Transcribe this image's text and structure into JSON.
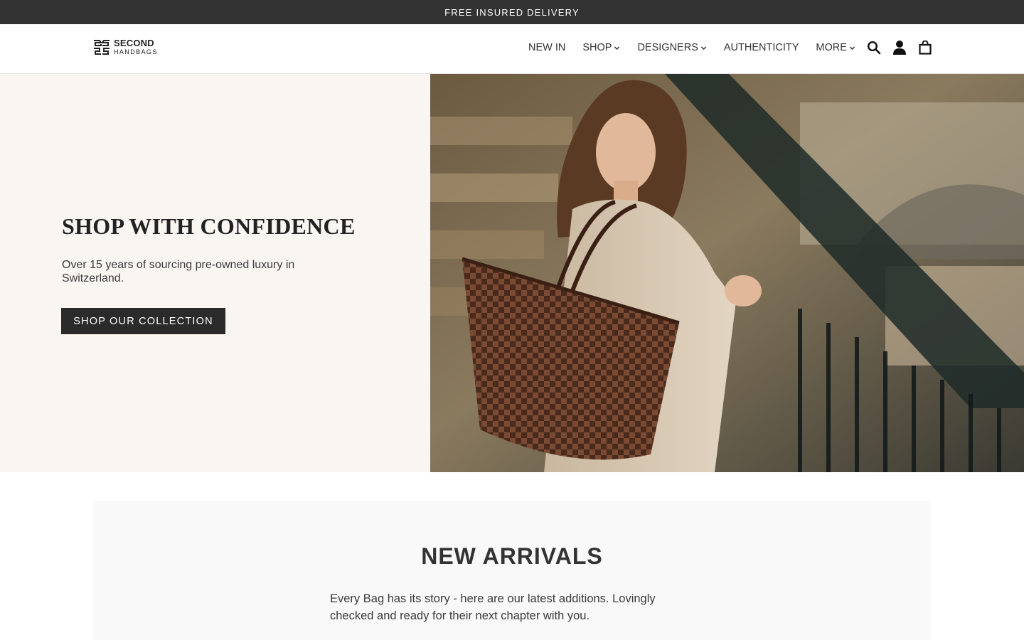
{
  "announcement": {
    "text": "FREE INSURED DELIVERY"
  },
  "header": {
    "logo": {
      "top": "SECOND",
      "bottom": "HANDBAGS"
    },
    "nav": [
      {
        "label": "NEW IN",
        "dropdown": false
      },
      {
        "label": "SHOP",
        "dropdown": true
      },
      {
        "label": "DESIGNERS",
        "dropdown": true
      },
      {
        "label": "AUTHENTICITY",
        "dropdown": false
      },
      {
        "label": "MORE",
        "dropdown": true
      }
    ],
    "icons": [
      "search-icon",
      "account-icon",
      "cart-icon"
    ]
  },
  "hero": {
    "title": "SHOP WITH CONFIDENCE",
    "subtitle": "Over 15 years of sourcing pre-owned luxury in Switzerland.",
    "button": "SHOP OUR COLLECTION",
    "background_color": "#f9f6f2"
  },
  "new_arrivals": {
    "title": "NEW ARRIVALS",
    "description": "Every Bag has its story - here are our latest additions. Lovingly checked and ready for their next chapter with you."
  },
  "colors": {
    "dark": "#333333",
    "button": "#2b2b2b",
    "hero_bg": "#f9f6f2",
    "section_bg": "#f9f9f9"
  }
}
